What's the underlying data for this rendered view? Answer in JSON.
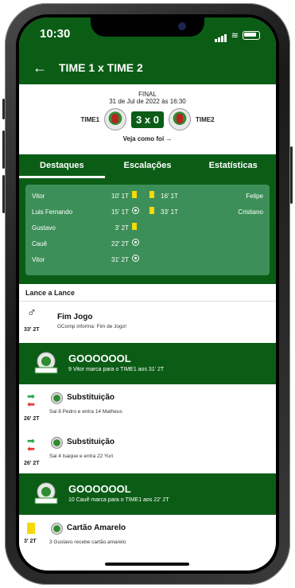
{
  "status": {
    "time": "10:30"
  },
  "header": {
    "title": "TIME 1 x TIME 2"
  },
  "match": {
    "stage": "FINAL",
    "date": "31 de Jul de 2022 às 16:30",
    "home": "TIME1",
    "away": "TIME2",
    "score": "3 x 0",
    "link": "Veja como foi →",
    "badge_text": "EPIPAN"
  },
  "tabs": [
    {
      "label": "Destaques",
      "active": true
    },
    {
      "label": "Escalações",
      "active": false
    },
    {
      "label": "Estatísticas",
      "active": false
    }
  ],
  "highlights": {
    "left": [
      {
        "name": "Vitor",
        "time": "10' 1T",
        "type": "yellow-card"
      },
      {
        "name": "Luis Fernando",
        "time": "15' 1T",
        "type": "goal"
      },
      {
        "name": "Gustavo",
        "time": "3' 2T",
        "type": "yellow-card"
      },
      {
        "name": "Cauê",
        "time": "22' 2T",
        "type": "goal"
      },
      {
        "name": "Vitor",
        "time": "31' 2T",
        "type": "goal"
      }
    ],
    "right": [
      {
        "name": "Felipe",
        "time": "16' 1T",
        "type": "yellow-card"
      },
      {
        "name": "Cristiano",
        "time": "33' 1T",
        "type": "yellow-card"
      }
    ]
  },
  "feed": {
    "title": "Lance a Lance",
    "events": [
      {
        "kind": "end",
        "minute": "33' 2T",
        "title": "Fim Jogo",
        "text": "GComp informa: Fim de Jogo!"
      },
      {
        "kind": "goal",
        "title": "GOOOOOOL",
        "text": "9 Vitor marca para o TIME1 aos 31' 2T"
      },
      {
        "kind": "sub",
        "minute": "26' 2T",
        "title": "Substituição",
        "text": "Sai 8 Pedro e entra 14 Matheus"
      },
      {
        "kind": "sub",
        "minute": "26' 2T",
        "title": "Substituição",
        "text": "Sai 4 Isaque e entra 22 Yuri"
      },
      {
        "kind": "goal",
        "title": "GOOOOOOL",
        "text": "10 Cauê marca para o TIME1 aos 22' 2T"
      },
      {
        "kind": "card",
        "minute": "3' 2T",
        "title": "Cartão Amarelo",
        "text": "3 Gustavo recebe cartão amarelo"
      }
    ]
  },
  "colors": {
    "primary": "#0b5d16",
    "card": "#3c8f58",
    "yellow": "#f5d90a"
  }
}
